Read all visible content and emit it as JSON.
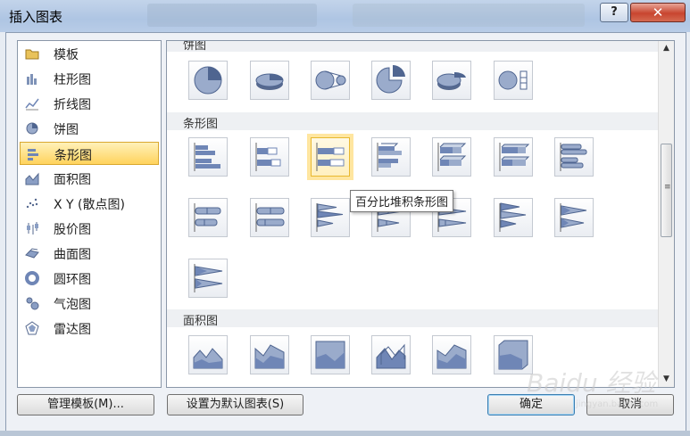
{
  "window": {
    "title": "插入图表",
    "help_label": "?",
    "close_label": "✕"
  },
  "categories": [
    {
      "label": "模板",
      "icon": "folder-icon"
    },
    {
      "label": "柱形图",
      "icon": "column-chart-icon"
    },
    {
      "label": "折线图",
      "icon": "line-chart-icon"
    },
    {
      "label": "饼图",
      "icon": "pie-chart-icon"
    },
    {
      "label": "条形图",
      "icon": "bar-chart-icon",
      "selected": true
    },
    {
      "label": "面积图",
      "icon": "area-chart-icon"
    },
    {
      "label": "X Y (散点图)",
      "icon": "scatter-chart-icon"
    },
    {
      "label": "股价图",
      "icon": "stock-chart-icon"
    },
    {
      "label": "曲面图",
      "icon": "surface-chart-icon"
    },
    {
      "label": "圆环图",
      "icon": "doughnut-chart-icon"
    },
    {
      "label": "气泡图",
      "icon": "bubble-chart-icon"
    },
    {
      "label": "雷达图",
      "icon": "radar-chart-icon"
    }
  ],
  "sections": {
    "pie": "饼图",
    "bar": "条形图",
    "area": "面积图"
  },
  "tooltip": "百分比堆积条形图",
  "buttons": {
    "manage_templates": "管理模板(M)...",
    "set_default": "设置为默认图表(S)",
    "ok": "确定",
    "cancel": "取消"
  },
  "watermark": {
    "main": "Baidu 经验",
    "sub": "jingyan.baidu.com"
  },
  "colors": {
    "accent": "#ffd35d",
    "thumb_fill": "#6f86b6"
  }
}
